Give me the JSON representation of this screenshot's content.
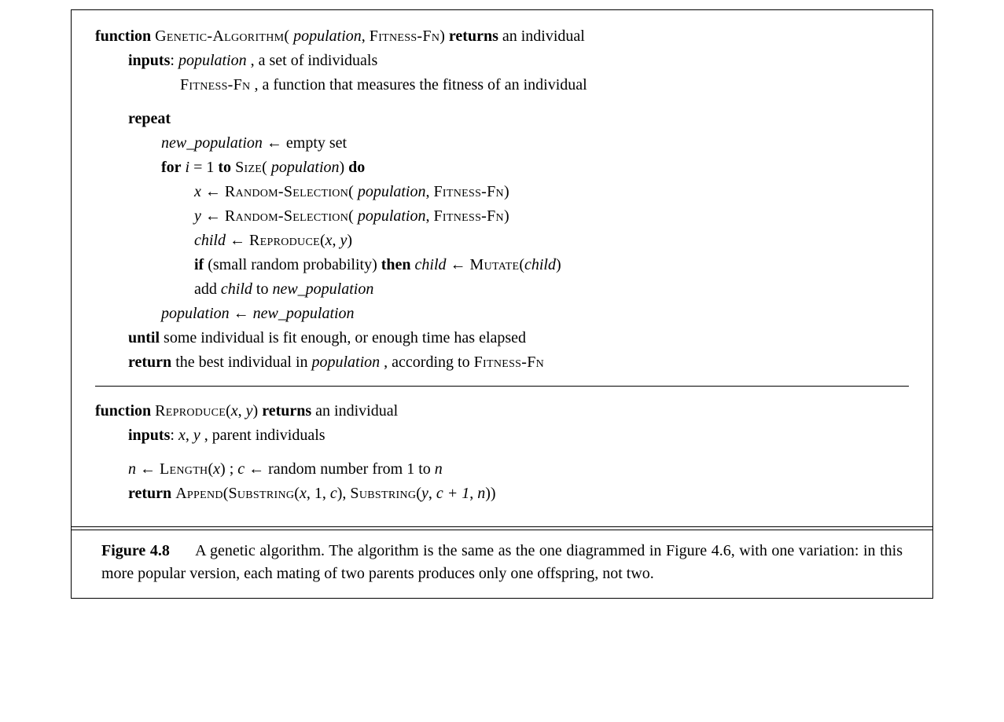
{
  "kw": {
    "function": "function",
    "returns": "returns",
    "inputs": "inputs",
    "repeat": "repeat",
    "for": "for",
    "to": "to",
    "do": "do",
    "if": "if",
    "then": "then",
    "until": "until",
    "return": "return"
  },
  "fn": {
    "genetic_algorithm": "Genetic-Algorithm",
    "fitness_fn": "Fitness-Fn",
    "size": "Size",
    "random_selection": "Random-Selection",
    "reproduce": "Reproduce",
    "mutate": "Mutate",
    "length": "Length",
    "append": "Append",
    "substring": "Substring"
  },
  "var": {
    "population": "population",
    "new_population": "new_population",
    "i": "i",
    "x": "x",
    "y": "y",
    "child": "child",
    "n": "n",
    "c": "c"
  },
  "txt": {
    "an_individual": "an individual",
    "set_of_individuals": ", a set of individuals",
    "fitness_desc": ", a function that measures the fitness of an individual",
    "empty_set": "empty set",
    "eq_one": " = 1 ",
    "small_random": "(small random probability) ",
    "add": "add ",
    "to_word": " to ",
    "until_clause": "some individual is fit enough, or enough time has elapsed",
    "return_best": "the best individual in ",
    "according_to": ", according to ",
    "parent_individuals": ", parent individuals",
    "rand_1_to_n": "random number from 1 to ",
    "one": "1",
    "c_plus_1": "c + 1",
    "arrow": " ← ",
    "semicolon_space": "; "
  },
  "caption": {
    "label": "Figure 4.8",
    "text": "A genetic algorithm. The algorithm is the same as the one diagrammed in Figure 4.6, with one variation: in this more popular version, each mating of two parents produces only one offspring, not two."
  }
}
